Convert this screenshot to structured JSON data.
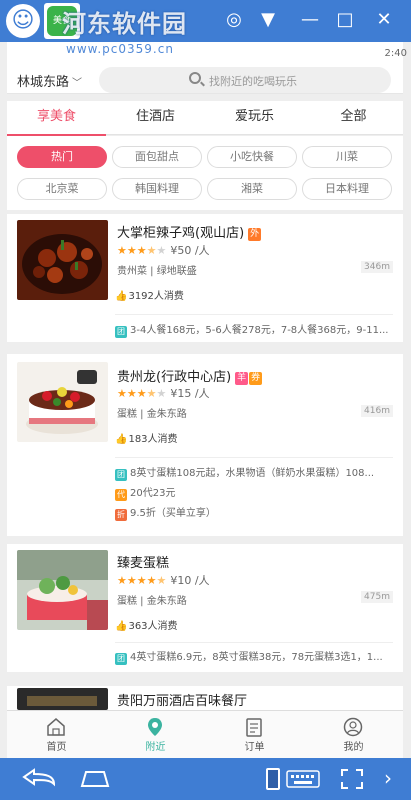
{
  "emulator": {
    "watermark": "河东软件园",
    "watermark_url": "www.pc0359.cn",
    "app_icon_label": "美食"
  },
  "status": {
    "time": "2:40"
  },
  "header": {
    "city": "林城东路",
    "search_placeholder": "找附近的吃喝玩乐"
  },
  "tabs": [
    "享美食",
    "住酒店",
    "爱玩乐",
    "全部"
  ],
  "active_tab": 0,
  "chips": [
    "热门",
    "面包甜点",
    "小吃快餐",
    "川菜",
    "北京菜",
    "韩国料理",
    "湘菜",
    "日本料理"
  ],
  "active_chip": 0,
  "cards": [
    {
      "name": "大掌柜辣子鸡(观山店)",
      "tags": [
        {
          "text": "外",
          "color": "#ff7a2a"
        }
      ],
      "rating": 3.5,
      "price": "¥50 /人",
      "category": "贵州菜 | 绿地联盛",
      "distance": "346m",
      "sales": "3192人消费",
      "deals": [
        {
          "badge": "团",
          "text": "3-4人餐168元，5-6人餐278元，7-8人餐368元，9-11..."
        }
      ]
    },
    {
      "name": "贵州龙(行政中心店)",
      "tags": [
        {
          "text": "羊",
          "color": "#ff5a8a"
        },
        {
          "text": "券",
          "color": "#ff9b1a"
        }
      ],
      "rating": 3.5,
      "price": "¥15 /人",
      "category": "蛋糕 | 金朱东路",
      "distance": "416m",
      "sales": "183人消费",
      "deals": [
        {
          "badge": "团",
          "text": "8英寸蛋糕108元起，水果物语（鲜奶水果蛋糕）108..."
        },
        {
          "badge": "代",
          "text": "20代23元"
        },
        {
          "badge": "折",
          "text": "9.5折（买单立享）"
        }
      ]
    },
    {
      "name": "臻麦蛋糕",
      "tags": [],
      "rating": 4.5,
      "price": "¥10 /人",
      "category": "蛋糕 | 金朱东路",
      "distance": "475m",
      "sales": "363人消费",
      "deals": [
        {
          "badge": "团",
          "text": "4英寸蛋糕6.9元，8英寸蛋糕38元，78元蛋糕3选1，1..."
        }
      ]
    },
    {
      "name": "贵阳万丽酒店百味餐厅"
    }
  ],
  "bottom_nav": [
    "首页",
    "附近",
    "订单",
    "我的"
  ],
  "active_nav": 1,
  "colors": {
    "accent": "#ee4f6a",
    "emulator_blue": "#3f7dd3",
    "star": "#ff9b1a",
    "nav_active": "#3bb3a0"
  }
}
